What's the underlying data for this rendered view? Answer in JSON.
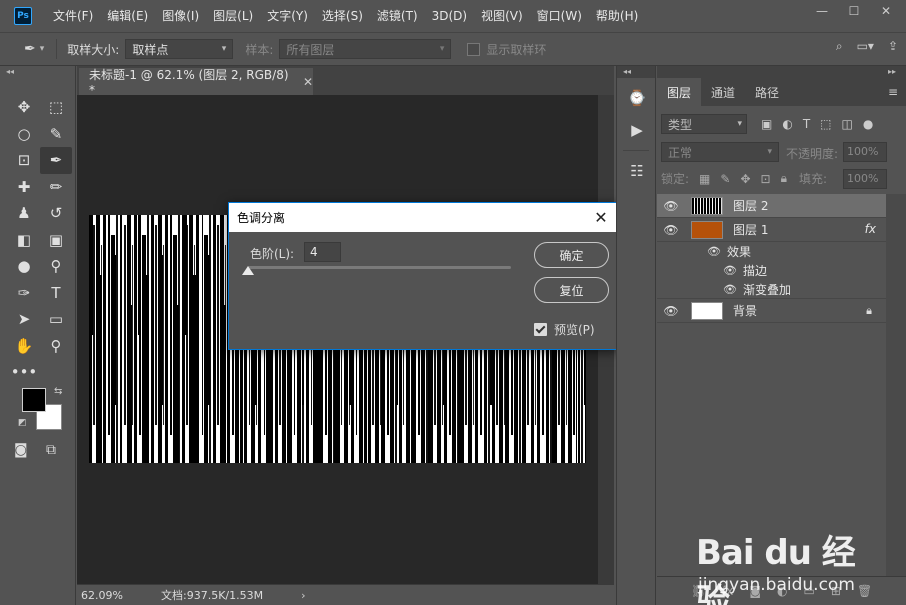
{
  "app": {
    "logo": "Ps"
  },
  "menu": [
    "文件(F)",
    "编辑(E)",
    "图像(I)",
    "图层(L)",
    "文字(Y)",
    "选择(S)",
    "滤镜(T)",
    "3D(D)",
    "视图(V)",
    "窗口(W)",
    "帮助(H)"
  ],
  "window_controls": {
    "minimize": "—",
    "maximize": "☐",
    "close": "✕"
  },
  "options": {
    "sample_size_label": "取样大小:",
    "sample_size_value": "取样点",
    "sample_label": "样本:",
    "sample_value": "所有图层",
    "show_ring_label": "显示取样环"
  },
  "document": {
    "tab_title": "未标题-1 @ 62.1% (图层 2, RGB/8) *",
    "zoom": "62.09%",
    "doc_info": "文档:937.5K/1.53M"
  },
  "dialog": {
    "title": "色调分离",
    "levels_label": "色阶(L):",
    "levels_value": "4",
    "ok": "确定",
    "reset": "复位",
    "preview": "预览(P)"
  },
  "layers_panel": {
    "tabs": [
      "图层",
      "通道",
      "路径"
    ],
    "filter": "类型",
    "blend_mode": "正常",
    "opacity_label": "不透明度:",
    "opacity_value": "100%",
    "lock_label": "锁定:",
    "fill_label": "填充:",
    "fill_value": "100%",
    "layers": [
      {
        "name": "图层 2",
        "selected": true
      },
      {
        "name": "图层 1",
        "fx": "fx",
        "thumb_color": "#b5510a"
      },
      {
        "name": "背景",
        "locked": true
      }
    ],
    "effects": {
      "label": "效果",
      "items": [
        "描边",
        "渐变叠加"
      ]
    }
  },
  "watermark": {
    "logo": "Bai du 经验",
    "url": "jingyan.baidu.com"
  },
  "colors": {
    "accent": "#0078d7",
    "layer1_thumb": "#b5510a"
  }
}
